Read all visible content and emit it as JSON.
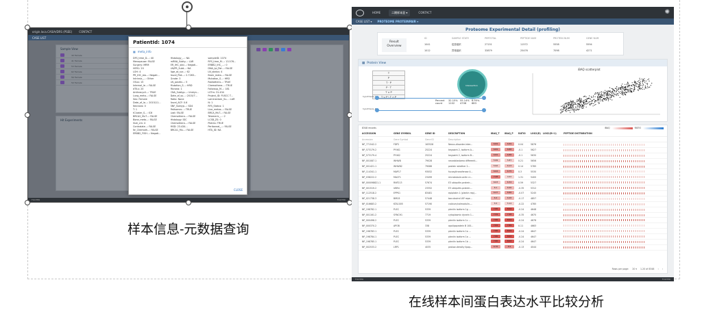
{
  "left_slide": {
    "caption": "样本信息-元数据查询",
    "app": {
      "nav_brand": "origin.loca.CASIA/DRS (PSEE)",
      "nav_contact": "CONTACT",
      "sub": "CASE LIST",
      "sample_view": "Sample View",
      "hit_experiments": "Hit Experiments",
      "footer_left": "FOOTER",
      "footer_right": "FOOTER"
    },
    "modal": {
      "title": "PatientId: 1074",
      "section": "meta_info",
      "close": "CLOSE",
      "fields": [
        "DFS_time_D...: 40",
        "Histology_...: NA",
        "samplelD: 1074",
        "Menopause: FALSE",
        "mRNA_Subty...: LAR",
        "RFS_time_M...: 13.576...",
        "Surgery: MRM",
        "ER_IHC_stai...: Negati...",
        "ERBB2_IHC_...: 0",
        "HER1: 20",
        "LN/PR_Subt...: NA",
        "DNA_Ipi_Pat...: FALSE",
        "LOH: 4",
        "Age_at_sur...: 62",
        "LN_status: 4",
        "PR_IHC_sta...: Negati...",
        "Ascel_Plat...: 2.7263...",
        "Brain_meta...: FALSE",
        "Intrinsic_...: Other",
        "Grade: 3",
        "Mutation_S...: HRD",
        "OSus: 15",
        "LN_positiv...: 5",
        "Radiothera...: TRUE",
        "Internal_le...: FALSE",
        "Mutation_S...: HRD",
        "Chemothera...: TRUE",
        "dTILs: 20",
        "Fibrosis: 1",
        "Followup_M...: 181",
        "Anthracycli...: TRUE",
        "CNA_Subtyp...: Unidyn...",
        "LSTm: 31.434",
        "Lung_meta...: FALSE",
        "Date_of_su...: 2015/7...",
        "Project_ID: FUSCC T...",
        "Sex: Female",
        "Ratio: None",
        "Laminectom_Su...: LAR",
        "Date_of_la...: 2015/11...",
        "Ascel_ACF: 0.6",
        "N: 1",
        "Necrosis: 0",
        "SNF_Subtyp...: SD4",
        "RFS_Status: 1",
        "T: 1",
        "Pathomec...: TRUE",
        "Live_metas...: FALSE",
        "tCluster_S...: IC6",
        "Lost: FALSE",
        "BRCA_MuT...: FALSE",
        "BRCA2_MuT...: FALSE",
        "Chemothera...: FALSE",
        "Telomeric_...: 2",
        "Bone_meta...: FALSE",
        "Histology: IDC",
        "LCSB_ZS: 0",
        "Size_cm: 4",
        "Chemothera...: FALSE",
        "Platins: TRUE",
        "Contralate...: FALSE",
        "MSD: 23.434...",
        "Peritoneal_...: FALSE",
        "Nr_Chemoth...: FALSE",
        "BRCA1_Mu...: FALSE",
        "HTA_ID: NA",
        "ERBB2_FISH...: Negati..."
      ]
    }
  },
  "right_slide": {
    "caption": "在线样本间蛋白表达水平比较分析",
    "app": {
      "nav": [
        "HOME",
        "二期样本显 ▾",
        "CONTACT"
      ],
      "sub": [
        "CASE LIST ▾",
        "PROTEOME PROTEINPAIR ▾"
      ],
      "title": "Proteome Experimental Detail (profiling)",
      "result_label": "Result Overview",
      "result_headers": [
        "ID",
        "SAMPLE STATE",
        "PERTOTAL",
        "PEPTIDE NUM",
        "PROTEIN NUM",
        "GENE NUM"
      ],
      "result_rows": [
        [
          "1041",
          "癌变组织",
          "27151",
          "11572",
          "5558",
          "5594"
        ],
        [
          "1012",
          "异常组织",
          "33879",
          "25476",
          "7098",
          "4271"
        ]
      ],
      "protein_view": "Protein View",
      "tabs": [
        "T",
        "P",
        "T · P",
        "P · T",
        "T ∪ P",
        "T ∪ P \\ T ∩ P"
      ],
      "venn_label": "Intersection",
      "pct_headers": [
        "Percent",
        "32.15%",
        "55.14%",
        "6.95%"
      ],
      "pct_values": [
        "count",
        "1102",
        "4706",
        "683"
      ],
      "slider_1": "hypothesis_T",
      "slider_2": "hypothesis_P",
      "scatter_title": "iBAQ scatterplot",
      "records": "8348 records",
      "legend_ibaq": "iBAQ",
      "legend_ratio": "RATIO",
      "columns": [
        "ACCESSION",
        "GENE SYMBOL",
        "GENE ID",
        "DESCRIPTION",
        "IBAQ_T",
        "IBAQ_P",
        "RATIO",
        "LOG2(R)",
        "LOG2(R+1)",
        "PEPTIDE DISTRIBUTION"
      ],
      "filters": [
        "Accession",
        "Gene Symbol",
        "Gene ID",
        "Description"
      ],
      "rows": [
        [
          "NP_771542.2",
          "FDP2",
          "163528",
          "Nexus-disorder-inter...",
          "6.84",
          "6.69",
          "0.04",
          "5876"
        ],
        [
          "NP_573179.2",
          "PY4K1",
          "25224",
          "keypoint 2, isoform A...",
          "6.84",
          "6.88",
          "-0.1",
          "5627"
        ],
        [
          "NP_573179.4",
          "PY4K2",
          "25224",
          "keypoint 2, isoform B...",
          "6.84",
          "6.88",
          "-0.1",
          "5630"
        ],
        [
          "NP_001087.1",
          "WHW8",
          "79028",
          "neuroblastoma differenti...",
          "5.99",
          "5.87",
          "0.21",
          "5656"
        ],
        [
          "NP_001421.1",
          "WHW82",
          "79086",
          "protein whether 2...",
          "5.92",
          "6.13",
          "0.14",
          "5785"
        ],
        [
          "NP_114341.1",
          "MAP17",
          "93052",
          "fucosyltransferase 4...",
          "6.64",
          "6.75",
          "0.3",
          "5530"
        ],
        [
          "NP_038222.2",
          "MACF1",
          "23499",
          "microtubule-actin cr...",
          "7.28",
          "4.22",
          "1.31",
          "5400"
        ],
        [
          "NP_000098821.1",
          "RNF213",
          "57674",
          "E3 ubiquitin-protein...",
          "6.03",
          "6.34",
          "0.59",
          "5327"
        ],
        [
          "NP_001519.2",
          "UBR4",
          "23352",
          "E3 ubiquitin-protein...",
          "6.1",
          "6.26",
          "-0.35",
          "5312"
        ],
        [
          "NP_112518.2",
          "EPPK1",
          "83481",
          "epiplakin 1 (plectin rep)...",
          "6.47",
          "6.66",
          "-0.07",
          "5245"
        ],
        [
          "NP_021738.3",
          "BIRC6",
          "57448",
          "baculoviral IAP repe...",
          "6.4",
          "6.28",
          "-0.17",
          "4857"
        ],
        [
          "NP_016683.2",
          "KTA1005",
          "57190",
          "calcium/calmodulin-...",
          "5.5",
          "5.14",
          "-0.22",
          "4785"
        ],
        [
          "NP_198782.1",
          "PLEC",
          "5339",
          "plectin isoform 1g ...",
          "7.86",
          "8.02",
          "-0.24",
          "4648"
        ],
        [
          "NP_001161.2",
          "SYNCH1",
          "7719",
          "cytoplasmic dynein 1...",
          "7.59",
          "7.48",
          "-0.35",
          "4670"
        ],
        [
          "NP_000498.2",
          "PLEC",
          "5339",
          "plectin isoform 1c ...",
          "7.86",
          "8.02",
          "-0.24",
          "4678"
        ],
        [
          "NP_000370.2",
          "APOB",
          "338",
          "apolipoprotein B 100...",
          "7.84",
          "7.89",
          "0.11",
          "4663"
        ],
        [
          "NP_198783.1",
          "PLEC",
          "5339",
          "plectin isoform 1a ...",
          "7.86",
          "8.02",
          "-0.24",
          "4647"
        ],
        [
          "NP_198784.1",
          "PLEC",
          "5339",
          "plectin isoform 1a ...",
          "7.86",
          "8.02",
          "-0.24",
          "4647"
        ],
        [
          "NP_198785.1",
          "PLEC",
          "5339",
          "plectin isoform 1b ...",
          "7.86",
          "8.02",
          "-0.24",
          "4647"
        ],
        [
          "NP_002533.2",
          "LRP1",
          "4035",
          "prolow-density lipop...",
          "6.76",
          "6.9",
          "-0.13",
          "4044"
        ]
      ],
      "pager_rows": "Rows per page:",
      "pager_size": "20 ▾",
      "pager_range": "1-20 of 8348",
      "pager_prev": "‹",
      "pager_next": "›",
      "footer_left": "FOOTER",
      "footer_right": "FOOTER"
    }
  }
}
